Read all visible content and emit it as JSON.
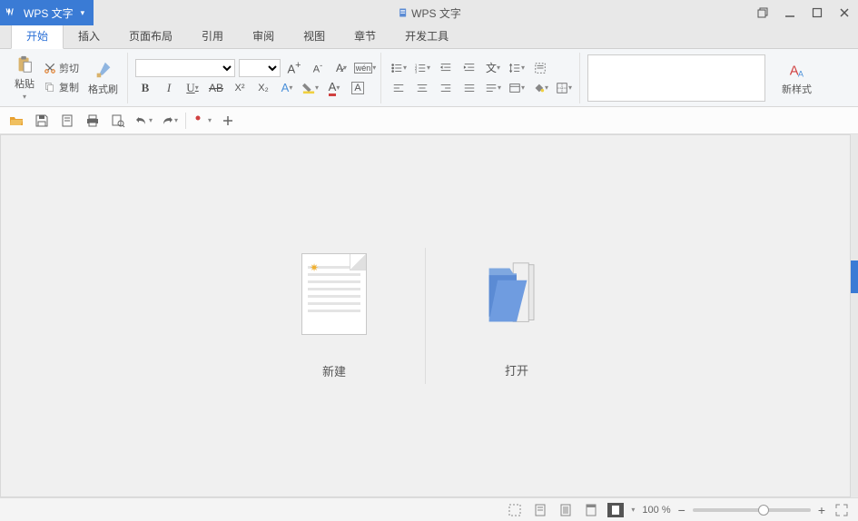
{
  "app": {
    "name": "WPS 文字",
    "title": "WPS 文字"
  },
  "tabs": [
    "开始",
    "插入",
    "页面布局",
    "引用",
    "审阅",
    "视图",
    "章节",
    "开发工具"
  ],
  "ribbon": {
    "paste": "粘贴",
    "cut": "剪切",
    "copy": "复制",
    "format_painter": "格式刷",
    "new_style": "新样式"
  },
  "main": {
    "new_doc": "新建",
    "open_doc": "打开"
  },
  "status": {
    "zoom": "100 %"
  }
}
